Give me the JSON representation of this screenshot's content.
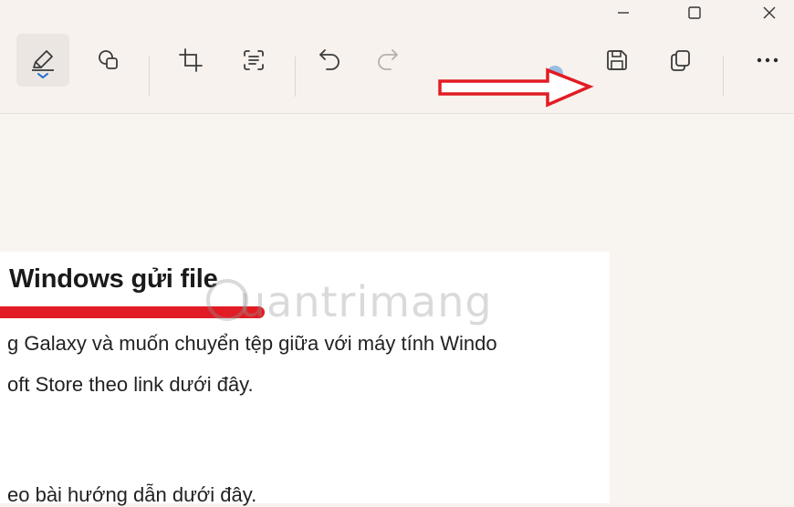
{
  "window": {
    "controls": [
      "minimize-icon",
      "maximize-icon",
      "close-icon"
    ]
  },
  "toolbar": {
    "tools": [
      {
        "icon": "highlighter-icon",
        "active": true
      },
      {
        "icon": "shapes-icon"
      },
      {
        "icon": "crop-icon"
      },
      {
        "icon": "text-actions-icon"
      },
      {
        "icon": "undo-icon"
      },
      {
        "icon": "redo-icon"
      },
      {
        "icon": "save-icon"
      },
      {
        "icon": "copy-icon"
      },
      {
        "icon": "more-icon"
      }
    ],
    "annotation": "red-arrow-icon"
  },
  "document": {
    "title": "Windows gửi file",
    "watermark": "uantrimang",
    "lines": [
      "g Galaxy và muốn chuyển tệp giữa với máy tính Windo",
      "oft Store theo link dưới đây.",
      "eo bài hướng dẫn dưới đây."
    ]
  },
  "colors": {
    "background": "#f7f2ee",
    "accent": "#e11c24",
    "icon": "#3b3b3b"
  }
}
